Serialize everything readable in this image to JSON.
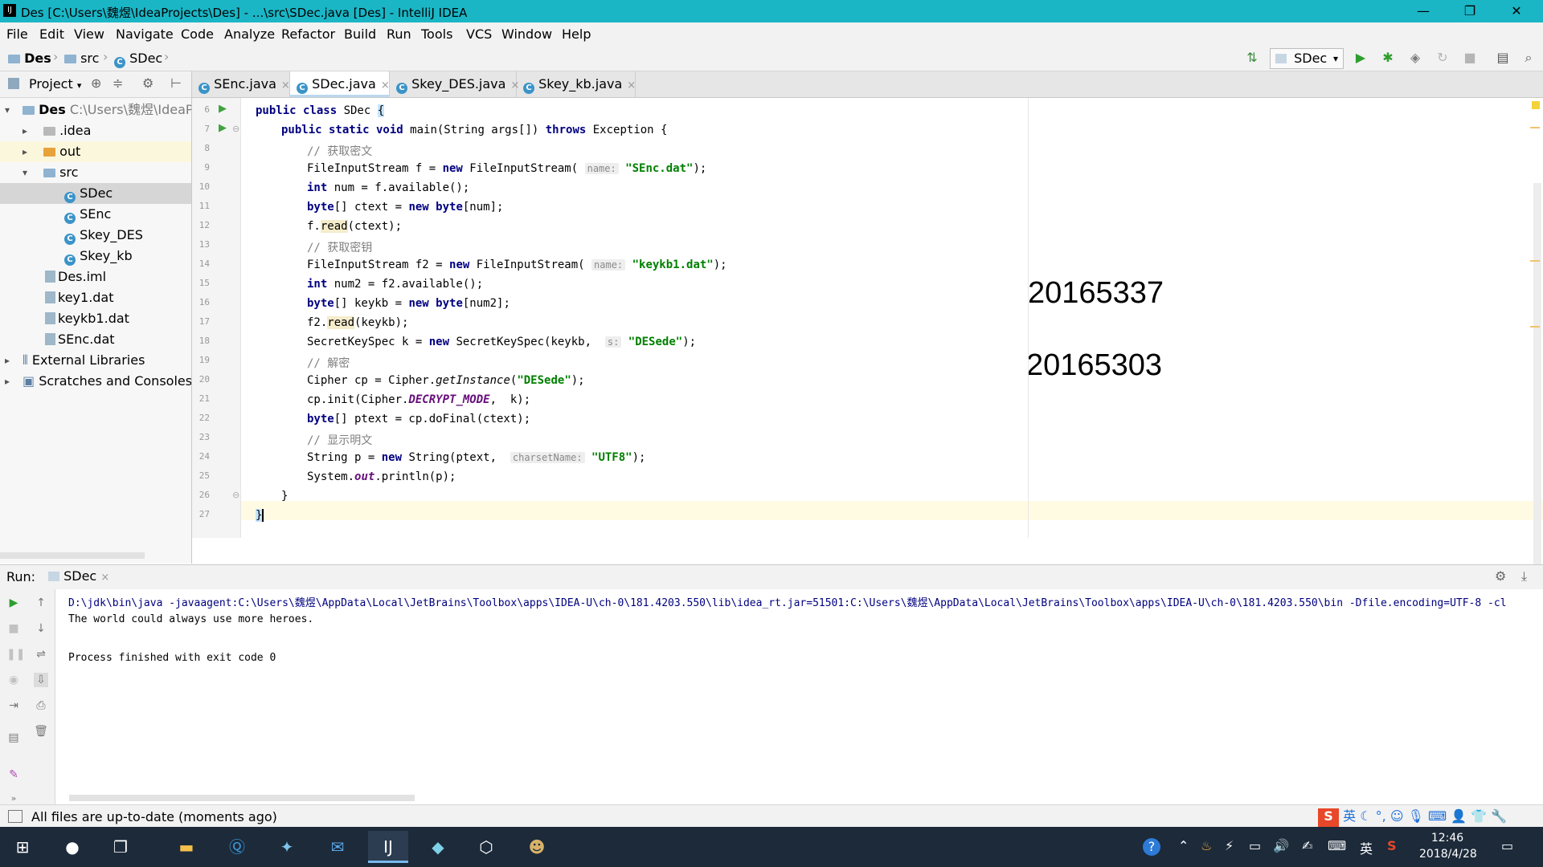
{
  "window": {
    "title": "Des [C:\\Users\\魏煜\\IdeaProjects\\Des] - ...\\src\\SDec.java [Des] - IntelliJ IDEA",
    "logo": "IJ"
  },
  "menu": [
    "File",
    "Edit",
    "View",
    "Navigate",
    "Code",
    "Analyze",
    "Refactor",
    "Build",
    "Run",
    "Tools",
    "VCS",
    "Window",
    "Help"
  ],
  "breadcrumb": [
    "Des",
    "src",
    "SDec"
  ],
  "run_config": "SDec",
  "project_panel": {
    "title": "Project",
    "tree": [
      {
        "label": "Des",
        "extra": "C:\\Users\\魏煜\\IdeaPro",
        "level": 0,
        "arrow": "▾"
      },
      {
        "label": ".idea",
        "level": 1,
        "arrow": "▸"
      },
      {
        "label": "out",
        "level": 1,
        "arrow": "▸"
      },
      {
        "label": "src",
        "level": 1,
        "arrow": "▾"
      },
      {
        "label": "SDec",
        "level": 2,
        "arrow": ""
      },
      {
        "label": "SEnc",
        "level": 2,
        "arrow": ""
      },
      {
        "label": "Skey_DES",
        "level": 2,
        "arrow": ""
      },
      {
        "label": "Skey_kb",
        "level": 2,
        "arrow": ""
      },
      {
        "label": "Des.iml",
        "level": 1,
        "arrow": ""
      },
      {
        "label": "key1.dat",
        "level": 1,
        "arrow": ""
      },
      {
        "label": "keykb1.dat",
        "level": 1,
        "arrow": ""
      },
      {
        "label": "SEnc.dat",
        "level": 1,
        "arrow": ""
      },
      {
        "label": "External Libraries",
        "level": 0,
        "arrow": "▸"
      },
      {
        "label": "Scratches and Consoles",
        "level": 0,
        "arrow": "▸"
      }
    ]
  },
  "tabs": [
    {
      "label": "SEnc.java",
      "close": "×"
    },
    {
      "label": "SDec.java",
      "close": "×"
    },
    {
      "label": "Skey_DES.java",
      "close": "×"
    },
    {
      "label": "Skey_kb.java",
      "close": "×"
    }
  ],
  "code": {
    "line_numbers": [
      "6",
      "7",
      "8",
      "9",
      "10",
      "11",
      "12",
      "13",
      "14",
      "15",
      "16",
      "17",
      "18",
      "19",
      "20",
      "21",
      "22",
      "23",
      "24",
      "25",
      "26",
      "27"
    ],
    "l6": {
      "a": "public class ",
      "b": "SDec ",
      "c": "{"
    },
    "l7": {
      "a": "public static void ",
      "b": "main(String args[]) ",
      "c": "throws ",
      "d": "Exception {"
    },
    "l8": "// 获取密文",
    "l9": {
      "a": "FileInputStream f = ",
      "b": "new ",
      "c": "FileInputStream( ",
      "hint": "name:",
      "str": "\"SEnc.dat\"",
      "d": ");"
    },
    "l10": {
      "a": "int ",
      "b": "num = f.available();"
    },
    "l11": {
      "a": "byte",
      "b": "[] ctext = ",
      "c": "new ",
      "d": "byte",
      "e": "[num];"
    },
    "l12": {
      "a": "f.",
      "b": "read",
      "c": "(ctext);"
    },
    "l13": "// 获取密钥",
    "l14": {
      "a": "FileInputStream f2 = ",
      "b": "new ",
      "c": "FileInputStream( ",
      "hint": "name:",
      "str": "\"keykb1.dat\"",
      "d": ");"
    },
    "l15": {
      "a": "int ",
      "b": "num2 = f2.available();"
    },
    "l16": {
      "a": "byte",
      "b": "[] keykb = ",
      "c": "new ",
      "d": "byte",
      "e": "[num2];"
    },
    "l17": {
      "a": "f2.",
      "b": "read",
      "c": "(keykb);"
    },
    "l18": {
      "a": "SecretKeySpec k = ",
      "b": "new ",
      "c": "SecretKeySpec(keykb,  ",
      "hint": "s:",
      "str": "\"DESede\"",
      "d": ");"
    },
    "l19": "// 解密",
    "l20": {
      "a": "Cipher cp = Cipher.",
      "b": "getInstance",
      "c": "(",
      "str": "\"DESede\"",
      "d": ");"
    },
    "l21": {
      "a": "cp.init(Cipher.",
      "b": "DECRYPT_MODE",
      "c": ",  k);"
    },
    "l22": {
      "a": "byte",
      "b": "[] ptext = cp.doFinal(ctext);"
    },
    "l23": "// 显示明文",
    "l24": {
      "a": "String p = ",
      "b": "new ",
      "c": "String(ptext,  ",
      "hint": "charsetName:",
      "str": "\"UTF8\"",
      "d": ");"
    },
    "l25": {
      "a": "System.",
      "b": "out",
      "c": ".println(p);"
    },
    "l26": "}",
    "l27": "}"
  },
  "overlay_numbers": [
    "20165337",
    "20165303"
  ],
  "run_panel": {
    "label": "Run:",
    "tab": "SDec",
    "close": "×",
    "lines": [
      "D:\\jdk\\bin\\java -javaagent:C:\\Users\\魏煜\\AppData\\Local\\JetBrains\\Toolbox\\apps\\IDEA-U\\ch-0\\181.4203.550\\lib\\idea_rt.jar=51501:C:\\Users\\魏煜\\AppData\\Local\\JetBrains\\Toolbox\\apps\\IDEA-U\\ch-0\\181.4203.550\\bin -Dfile.encoding=UTF-8 -cl",
      "The world could always use more heroes.",
      "",
      "Process finished with exit code 0"
    ]
  },
  "status": "All files are up-to-date (moments ago)",
  "ime": {
    "lang": "英",
    "logo": "S"
  },
  "taskbar": {
    "time": "12:46",
    "date": "2018/4/28",
    "ime_lang": "英"
  },
  "colors": {
    "titlebar": "#1ab6c6",
    "keyword": "#000080",
    "string": "#008000",
    "comment": "#808080",
    "taskbar": "#1c2a3a"
  }
}
